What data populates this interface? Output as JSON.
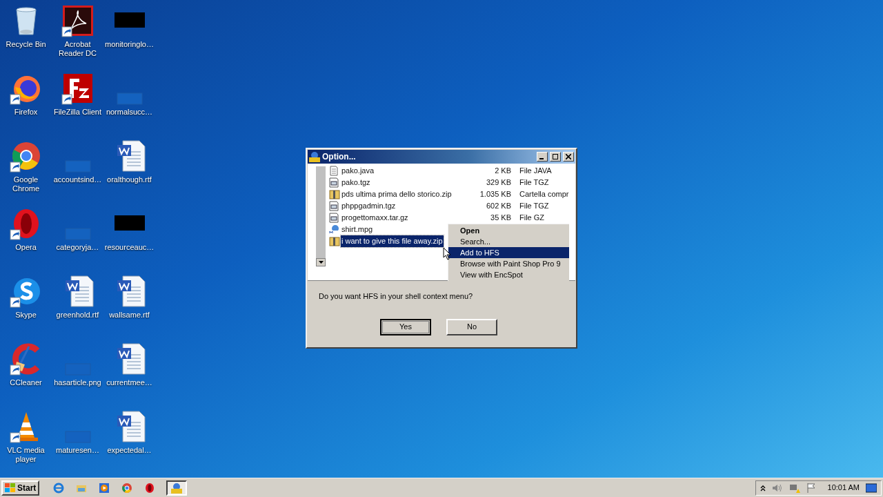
{
  "desktop_icons": [
    {
      "label": "Recycle Bin",
      "kind": "recycle",
      "shortcut": false
    },
    {
      "label": "Firefox",
      "kind": "firefox",
      "shortcut": true
    },
    {
      "label": "Google Chrome",
      "kind": "chrome",
      "shortcut": true
    },
    {
      "label": "Opera",
      "kind": "opera",
      "shortcut": true
    },
    {
      "label": "Skype",
      "kind": "skype",
      "shortcut": true
    },
    {
      "label": "CCleaner",
      "kind": "ccleaner",
      "shortcut": true
    },
    {
      "label": "VLC media player",
      "kind": "vlc",
      "shortcut": true
    },
    {
      "label": "Acrobat Reader DC",
      "kind": "acrobat",
      "shortcut": true
    },
    {
      "label": "FileZilla Client",
      "kind": "filezilla",
      "shortcut": true
    },
    {
      "label": "accountsind…",
      "kind": "blank",
      "shortcut": false
    },
    {
      "label": "categoryja…",
      "kind": "blank",
      "shortcut": false
    },
    {
      "label": "greenhold.rtf",
      "kind": "word",
      "shortcut": false
    },
    {
      "label": "hasarticle.png",
      "kind": "blank",
      "shortcut": false
    },
    {
      "label": "maturesen…",
      "kind": "blank",
      "shortcut": false
    },
    {
      "label": "monitoringlo…",
      "kind": "dark",
      "shortcut": false
    },
    {
      "label": "normalsucc…",
      "kind": "blank",
      "shortcut": false
    },
    {
      "label": "oralthough.rtf",
      "kind": "word",
      "shortcut": false
    },
    {
      "label": "resourceauc…",
      "kind": "dark",
      "shortcut": false
    },
    {
      "label": "wallsame.rtf",
      "kind": "word",
      "shortcut": false
    },
    {
      "label": "currentmee…",
      "kind": "word",
      "shortcut": false
    },
    {
      "label": "expectedal…",
      "kind": "word",
      "shortcut": false
    }
  ],
  "dialog": {
    "title": "Option...",
    "files": [
      {
        "name": "pako.java",
        "size": "2 KB",
        "type": "File JAVA",
        "kind": "text",
        "selected": false
      },
      {
        "name": "pako.tgz",
        "size": "329 KB",
        "type": "File TGZ",
        "kind": "archive",
        "selected": false
      },
      {
        "name": "pds ultima prima dello storico.zip",
        "size": "1.035 KB",
        "type": "Cartella compr",
        "kind": "zip",
        "selected": false
      },
      {
        "name": "phppgadmin.tgz",
        "size": "602 KB",
        "type": "File TGZ",
        "kind": "archive",
        "selected": false
      },
      {
        "name": "progettomaxx.tar.gz",
        "size": "35 KB",
        "type": "File GZ",
        "kind": "archive",
        "selected": false
      },
      {
        "name": "shirt.mpg",
        "kind": "video",
        "selected": false
      },
      {
        "name": "i want to give this file away.zip",
        "kind": "zip",
        "selected": true
      }
    ],
    "context_menu": [
      {
        "label": "Open",
        "default": true,
        "selected": false
      },
      {
        "label": "Search...",
        "default": false,
        "selected": false
      },
      {
        "label": "Add to HFS",
        "default": false,
        "selected": true
      },
      {
        "label": "Browse with Paint Shop Pro 9",
        "default": false,
        "selected": false
      },
      {
        "label": "View with EncSpot",
        "default": false,
        "selected": false
      }
    ],
    "question": "Do you want HFS in your shell context menu?",
    "buttons": [
      {
        "label": "Yes",
        "default": true
      },
      {
        "label": "No",
        "default": false
      }
    ]
  },
  "taskbar": {
    "start": "Start",
    "tasks": [
      {
        "selected": true
      }
    ],
    "clock": "10:01 AM"
  }
}
